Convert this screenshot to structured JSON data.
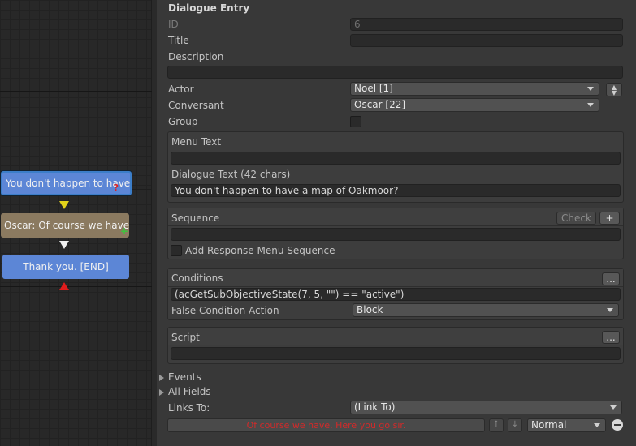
{
  "graph": {
    "nodes": [
      {
        "text": "You don't happen to have a map of Oakmoor?",
        "badge": "?"
      },
      {
        "text": "Oscar: Of course we have. Here you go sir.",
        "badge": "+"
      },
      {
        "text": "Thank you. [END]"
      }
    ]
  },
  "inspector": {
    "section_title": "Dialogue Entry",
    "id_label": "ID",
    "id_value": "6",
    "title_label": "Title",
    "title_value": "",
    "description_label": "Description",
    "description_value": "",
    "actor_label": "Actor",
    "actor_value": "Noel [1]",
    "conversant_label": "Conversant",
    "conversant_value": "Oscar [22]",
    "group_label": "Group",
    "menu_text_label": "Menu Text",
    "menu_text_value": "",
    "dialogue_text_label": "Dialogue Text (42 chars)",
    "dialogue_text_value": "You don't happen to have a map of Oakmoor?",
    "sequence_label": "Sequence",
    "check_button": "Check",
    "add_button": "+",
    "sequence_value": "",
    "add_response_menu_sequence_label": "Add Response Menu Sequence",
    "conditions_label": "Conditions",
    "more_button": "...",
    "conditions_value": "(acGetSubObjectiveState(7, 5, \"\")  == \"active\")",
    "false_condition_action_label": "False Condition Action",
    "false_condition_action_value": "Block",
    "script_label": "Script",
    "script_value": "",
    "events_label": "Events",
    "all_fields_label": "All Fields",
    "links_to_label": "Links To:",
    "links_to_value": "(Link To)",
    "link_entry_text": "Of course we have. Here you go sir.",
    "link_priority_value": "Normal"
  },
  "colors": {
    "node_player": "#5c86d6",
    "node_npc": "#8b7a60",
    "link_text": "#d22a2a"
  },
  "icons": [
    "question-mark-icon",
    "plus-icon",
    "arrow-down-icon",
    "arrow-up-icon",
    "caret-down-icon",
    "triangle-right-icon",
    "remove-icon"
  ]
}
